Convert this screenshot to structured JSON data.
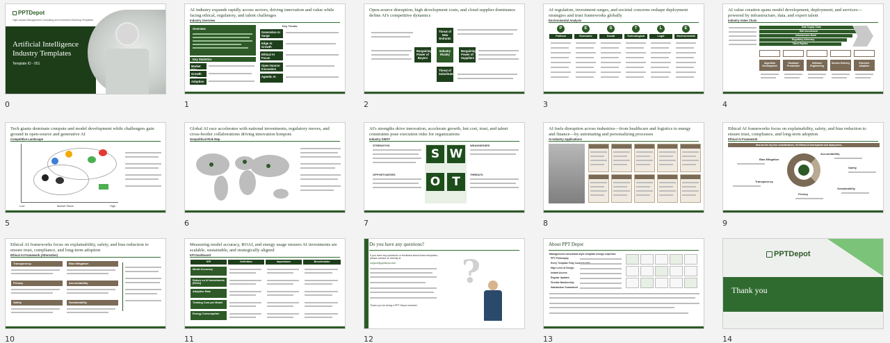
{
  "slides": [
    {
      "index": "0",
      "brand": "PPTDepot",
      "tagline": "High-Impact Management Consulting and Investment Banking Templates",
      "title": "Artificial Intelligence Industry Templates",
      "template_id": "Template ID - 051"
    },
    {
      "index": "1",
      "title": "AI industry expands rapidly across sectors, driving innovation and value while facing ethical, regulatory, and talent challenges",
      "subtitle": "Industry Overview",
      "panel_heading": "Overview",
      "key_stats_heading": "Key Statistics",
      "key_trends_heading": "Key Trends",
      "stats": [
        "Market Size",
        "Growth Rate",
        "Adoption"
      ],
      "trends": [
        "Generative AI Surge",
        "Edge AI Growth",
        "Ethical AI Focus",
        "Open-Source Innovation",
        "Agentic AI"
      ]
    },
    {
      "index": "2",
      "title": "Open-source disruption, high development costs, and cloud supplier dominance define AI's competitive dynamics",
      "subtitle": "Porter's Five Forces",
      "forces": [
        "Threat of New Entrants",
        "Bargaining Power of Buyers",
        "Industry Rivalry",
        "Bargaining Power of Suppliers",
        "Threat of Substitutes"
      ]
    },
    {
      "index": "3",
      "title": "AI regulation, investment surges, and societal concerns reshape deployment strategies and trust frameworks globally",
      "subtitle": "Environmental Analysis",
      "letters": [
        "P",
        "E",
        "S",
        "T",
        "L",
        "E"
      ],
      "columns": [
        "Political",
        "Economic",
        "Social",
        "Technological",
        "Legal",
        "Environmental"
      ]
    },
    {
      "index": "4",
      "title": "AI value creation spans model development, deployment, and services—powered by infrastructure, data, and expert talent",
      "subtitle": "Industry Value Chain",
      "bars": [
        "Data Supply Chain",
        "R&D Investments",
        "Infrastructure Build",
        "Regulatory Advocacy",
        "Talent Pipeline"
      ],
      "stages": [
        "Algorithm Development",
        "Hardware Production",
        "Software Engineering",
        "Service Delivery",
        "End-User Adoption"
      ]
    },
    {
      "index": "5",
      "title": "Tech giants dominate compute and model development while challengers gain ground in open-source and generative AI",
      "subtitle": "Competitive Landscape",
      "axis_x_low": "Low",
      "axis_x_mid": "Market Share",
      "axis_x_high": "High"
    },
    {
      "index": "6",
      "title": "Global AI race accelerates with national investments, regulatory moves, and cross-border collaborations driving innovation hotspots",
      "subtitle": "Geopolitical Risk Map"
    },
    {
      "index": "7",
      "title": "AI's strengths drive innovation, accelerate growth, but cost, trust, and talent constraints pose execution risks for organizations",
      "subtitle": "Industry SWOT",
      "swot": [
        "S",
        "W",
        "O",
        "T"
      ],
      "headings": [
        "STRENGTHS",
        "WEAKNESSES",
        "OPPORTUNITIES",
        "THREATS"
      ]
    },
    {
      "index": "8",
      "title": "AI fuels disruption across industries—from healthcare and logistics to energy and finance—by automating and personalizing processes",
      "subtitle": "AI Industry Applications"
    },
    {
      "index": "9",
      "title": "Ethical AI frameworks focus on explainability, safety, and bias reduction to ensure trust, compliance, and long-term adoption",
      "subtitle": "Ethical AI Framework",
      "banner": "How are the key four considerations, the Ethical AI development and deployment...",
      "labels": [
        "Bias Mitigation",
        "Accountability",
        "Safety",
        "Transparency",
        "Privacy",
        "Sustainability"
      ]
    },
    {
      "index": "10",
      "title": "Ethical AI frameworks focus on explainability, safety, and bias reduction to ensure trust, compliance, and long-term adoption",
      "subtitle": "Ethical AI Framework (Alternative)",
      "cards": [
        "Transparency",
        "Bias Mitigation",
        "Privacy",
        "Accountability",
        "Safety",
        "Sustainability"
      ]
    },
    {
      "index": "11",
      "title": "Measuring model accuracy, ROAI, and energy usage ensures AI investments are scalable, sustainable, and strategically aligned",
      "subtitle": "KPI Dashboard",
      "headers": [
        "KPI",
        "Definition",
        "Importance",
        "Benchmarks"
      ],
      "rows": [
        "Model Accuracy",
        "Return on AI Investments (ROAI)",
        "Adoption Rate",
        "Training Cost per Model",
        "Energy Consumption"
      ]
    },
    {
      "index": "12",
      "title": "Do you have any questions?",
      "line1": "If you have any questions or feedback about these templates, please contact us directly at",
      "email": "support@pptdepot.com",
      "sig": "Thank you for being a PPT Depot member!"
    },
    {
      "index": "13",
      "title": "About PPT Depot",
      "heading": "Management consultant-style template design expertise",
      "bullets": [
        "PPT Philosophy",
        "Every Template Fully Customizable",
        "High Level of Design",
        "Instant Access",
        "Regular Updates",
        "Flexible Membership",
        "Satisfaction Guaranteed"
      ]
    },
    {
      "index": "14",
      "brand": "PPTDepot",
      "title": "Thank you"
    }
  ],
  "colors": {
    "green": "#2d5a27",
    "dark_green": "#1e3f1b",
    "brown": "#7a6a56"
  }
}
